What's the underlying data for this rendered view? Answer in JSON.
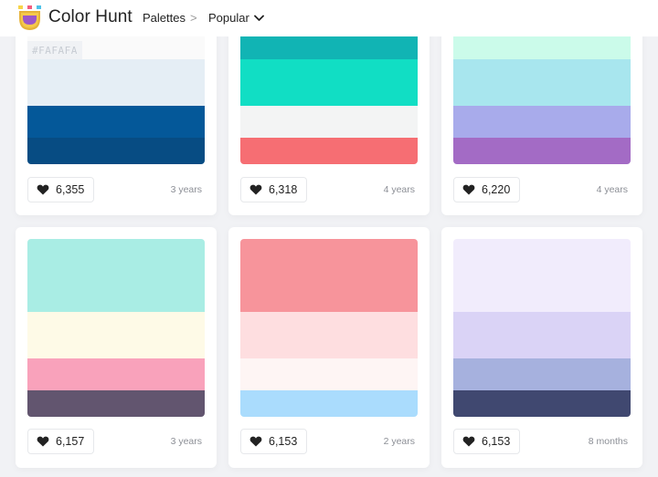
{
  "header": {
    "brand": "Color Hunt",
    "nav_palettes": "Palettes",
    "nav_separator": ">",
    "nav_popular": "Popular"
  },
  "cards": [
    {
      "colors": [
        "#FAFAFA",
        "#E5EEF5",
        "#045899",
        "#074C83"
      ],
      "hex_label": "#FAFAFA",
      "likes": "6,355",
      "date": "3 years"
    },
    {
      "colors": [
        "#11B4B4",
        "#11DEC4",
        "#F3F4F4",
        "#F66E73"
      ],
      "likes": "6,318",
      "date": "4 years"
    },
    {
      "colors": [
        "#CBFBEA",
        "#A8E6EE",
        "#A8ABEB",
        "#A36BC5"
      ],
      "likes": "6,220",
      "date": "4 years"
    },
    {
      "colors": [
        "#A9EDE4",
        "#FEFAE7",
        "#F9A2BB",
        "#62556F"
      ],
      "likes": "6,157",
      "date": "3 years"
    },
    {
      "colors": [
        "#F7949B",
        "#FEDEE0",
        "#FEF5F4",
        "#AADCFD"
      ],
      "likes": "6,153",
      "date": "2 years"
    },
    {
      "colors": [
        "#F1ECFC",
        "#DAD3F6",
        "#A6B1DE",
        "#404870"
      ],
      "likes": "6,153",
      "date": "8 months"
    }
  ]
}
